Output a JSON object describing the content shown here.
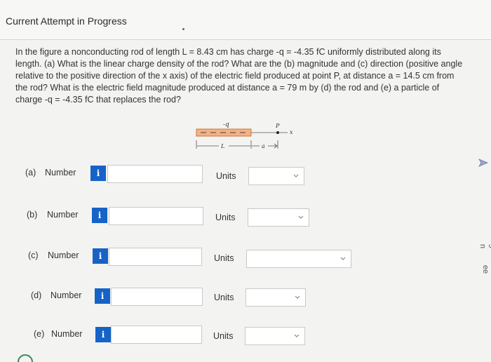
{
  "header": {
    "title": "Current Attempt in Progress"
  },
  "problem": {
    "text": "In the figure a nonconducting rod of length L = 8.43 cm has charge -q = -4.35 fC uniformly distributed along its length. (a) What is the linear charge density of the rod? What are the (b) magnitude and (c) direction (positive angle relative to the positive direction of the x axis) of the electric field produced at point P, at distance a = 14.5 cm from the rod? What is the electric field magnitude produced at distance a = 79 m by (d) the rod and (e) a particle of charge -q = -4.35 fC that replaces the rod?"
  },
  "figure": {
    "charge_label": "-q",
    "point_label": "P",
    "axis_label": "x",
    "length_label": "L",
    "distance_label": "a",
    "rod_color": "#f4b183",
    "rod_border": "#c77a3c"
  },
  "parts": [
    {
      "part": "(a)",
      "label": "Number",
      "info": "i",
      "value": "",
      "units_label": "Units",
      "units_value": ""
    },
    {
      "part": "(b)",
      "label": "Number",
      "info": "i",
      "value": "",
      "units_label": "Units",
      "units_value": ""
    },
    {
      "part": "(c)",
      "label": "Number",
      "info": "i",
      "value": "",
      "units_label": "Units",
      "units_value": ""
    },
    {
      "part": "(d)",
      "label": "Number",
      "info": "i",
      "value": "",
      "units_label": "Units",
      "units_value": ""
    },
    {
      "part": "(e)",
      "label": "Number",
      "info": "i",
      "value": "",
      "units_label": "Units",
      "units_value": ""
    }
  ],
  "colors": {
    "accent": "#1663c7",
    "background": "#f3f3f1"
  }
}
